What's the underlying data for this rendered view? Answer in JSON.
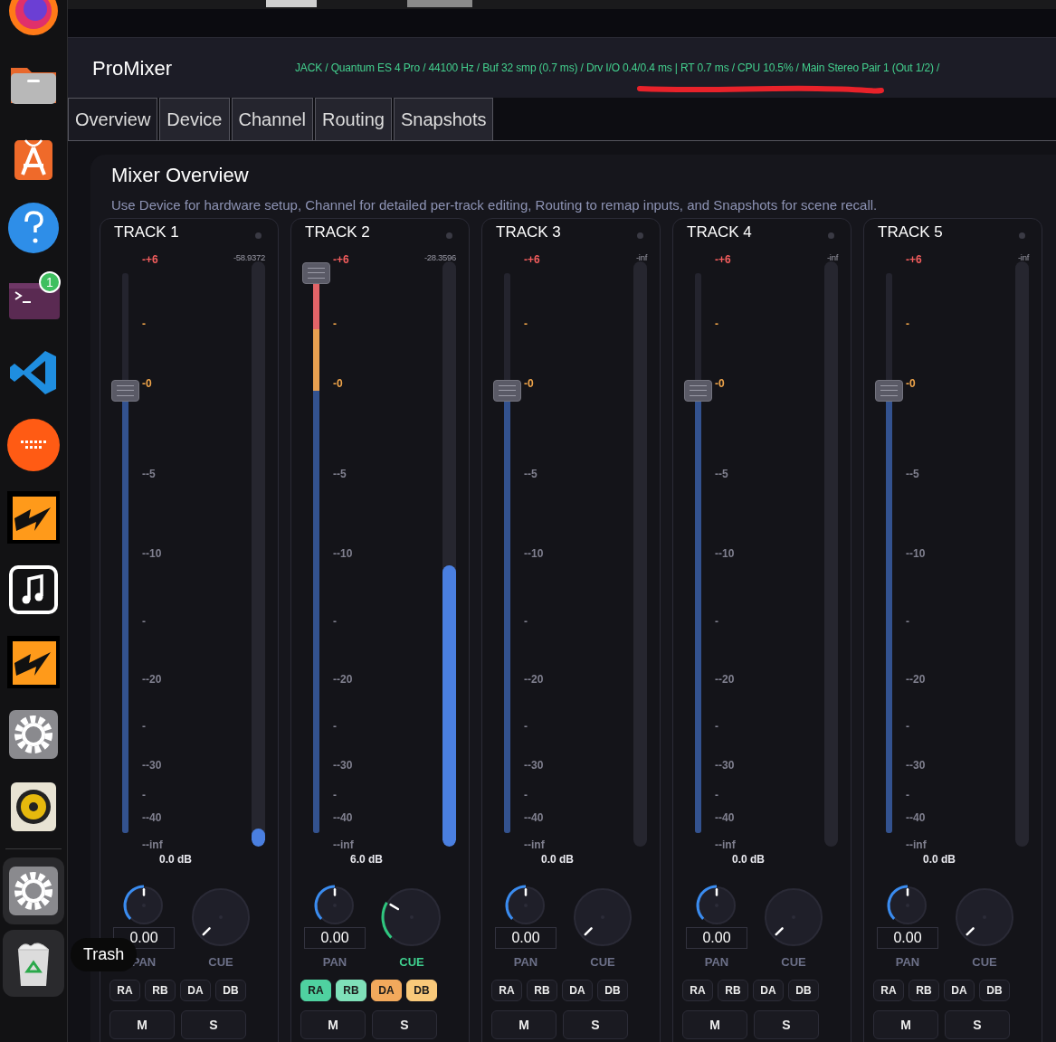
{
  "dock": {
    "items": [
      {
        "kind": "browser",
        "highlighted": false
      },
      {
        "kind": "folder",
        "highlighted": false
      },
      {
        "kind": "store",
        "highlighted": false
      },
      {
        "kind": "help",
        "highlighted": false
      },
      {
        "kind": "terminal",
        "highlighted": false,
        "badge": "1"
      },
      {
        "kind": "code",
        "highlighted": false
      },
      {
        "kind": "dots",
        "highlighted": false
      },
      {
        "kind": "lightning",
        "highlighted": false
      },
      {
        "kind": "music",
        "highlighted": false
      },
      {
        "kind": "lightning",
        "highlighted": false
      },
      {
        "kind": "gear",
        "highlighted": false
      },
      {
        "kind": "speaker",
        "highlighted": false
      },
      {
        "kind": "separator"
      },
      {
        "kind": "gear",
        "highlighted": true
      },
      {
        "kind": "trash",
        "highlighted": true
      }
    ],
    "tooltip": "Trash"
  },
  "app": {
    "title": "ProMixer",
    "status": "JACK / Quantum ES 4 Pro / 44100 Hz / Buf 32 smp (0.7 ms) / Drv I/O 0.4/0.4 ms | RT 0.7 ms / CPU 10.5% / Main Stereo Pair 1 (Out 1/2) /"
  },
  "tabs": [
    {
      "label": "Overview",
      "selected": true
    },
    {
      "label": "Device",
      "selected": false
    },
    {
      "label": "Channel",
      "selected": false
    },
    {
      "label": "Routing",
      "selected": false
    },
    {
      "label": "Snapshots",
      "selected": false
    }
  ],
  "panel": {
    "title": "Mixer Overview",
    "description": "Use Device for hardware setup, Channel for detailed per-track editing, Routing to remap inputs, and Snapshots for scene recall."
  },
  "tracks": [
    {
      "name": "TRACK 1",
      "peak": "-58.9372",
      "level": 0.79,
      "meter": {
        "level": 0.03
      },
      "scale": [
        {
          "label": "-+6",
          "kind": "hot"
        },
        {
          "label": "-",
          "kind": "warm"
        },
        {
          "label": "-0",
          "kind": "warm"
        },
        {
          "label": "--5",
          "kind": "normal"
        },
        {
          "label": "--10",
          "kind": "normal"
        },
        {
          "label": "-",
          "kind": "normal"
        },
        {
          "label": "--20",
          "kind": "normal"
        },
        {
          "label": "-",
          "kind": "normal"
        },
        {
          "label": "--30",
          "kind": "normal"
        },
        {
          "label": "-",
          "kind": "normal"
        },
        {
          "label": "--40",
          "kind": "normal"
        },
        {
          "label": "--inf",
          "kind": "normal"
        }
      ],
      "gain": "0.0 dB",
      "pan": {
        "level": 0.5,
        "value": "0.00",
        "label": "PAN"
      },
      "cue": {
        "active": false,
        "label": "CUE"
      },
      "sends": [
        {
          "label": "RA",
          "on": false
        },
        {
          "label": "RB",
          "on": false
        },
        {
          "label": "DA",
          "on": false
        },
        {
          "label": "DB",
          "on": false
        }
      ],
      "mute": "M",
      "solo": "S"
    },
    {
      "name": "TRACK 2",
      "peak": "-28.3596",
      "level": 1.0,
      "meter": {
        "level": 0.48
      },
      "scale": [
        {
          "label": "-+6",
          "kind": "hot"
        },
        {
          "label": "-",
          "kind": "warm"
        },
        {
          "label": "-0",
          "kind": "warm"
        },
        {
          "label": "--5",
          "kind": "normal"
        },
        {
          "label": "--10",
          "kind": "normal"
        },
        {
          "label": "-",
          "kind": "normal"
        },
        {
          "label": "--20",
          "kind": "normal"
        },
        {
          "label": "-",
          "kind": "normal"
        },
        {
          "label": "--30",
          "kind": "normal"
        },
        {
          "label": "-",
          "kind": "normal"
        },
        {
          "label": "--40",
          "kind": "normal"
        },
        {
          "label": "--inf",
          "kind": "normal"
        }
      ],
      "gain": "6.0 dB",
      "pan": {
        "level": 0.5,
        "value": "0.00",
        "label": "PAN"
      },
      "cue": {
        "active": true,
        "label": "CUE"
      },
      "sends": [
        {
          "label": "RA",
          "on": true,
          "color": "#4fd1a0"
        },
        {
          "label": "RB",
          "on": true,
          "color": "#7fe0b9"
        },
        {
          "label": "DA",
          "on": true,
          "color": "#f2a95c"
        },
        {
          "label": "DB",
          "on": true,
          "color": "#f9c97a"
        }
      ],
      "mute": "M",
      "solo": "S"
    },
    {
      "name": "TRACK 3",
      "peak": "-inf",
      "level": 0.79,
      "meter": {
        "level": 0
      },
      "scale": [
        {
          "label": "-+6",
          "kind": "hot"
        },
        {
          "label": "-",
          "kind": "warm"
        },
        {
          "label": "-0",
          "kind": "warm"
        },
        {
          "label": "--5",
          "kind": "normal"
        },
        {
          "label": "--10",
          "kind": "normal"
        },
        {
          "label": "-",
          "kind": "normal"
        },
        {
          "label": "--20",
          "kind": "normal"
        },
        {
          "label": "-",
          "kind": "normal"
        },
        {
          "label": "--30",
          "kind": "normal"
        },
        {
          "label": "-",
          "kind": "normal"
        },
        {
          "label": "--40",
          "kind": "normal"
        },
        {
          "label": "--inf",
          "kind": "normal"
        }
      ],
      "gain": "0.0 dB",
      "pan": {
        "level": 0.5,
        "value": "0.00",
        "label": "PAN"
      },
      "cue": {
        "active": false,
        "label": "CUE"
      },
      "sends": [
        {
          "label": "RA",
          "on": false
        },
        {
          "label": "RB",
          "on": false
        },
        {
          "label": "DA",
          "on": false
        },
        {
          "label": "DB",
          "on": false
        }
      ],
      "mute": "M",
      "solo": "S"
    },
    {
      "name": "TRACK 4",
      "peak": "-inf",
      "level": 0.79,
      "meter": {
        "level": 0
      },
      "scale": [
        {
          "label": "-+6",
          "kind": "hot"
        },
        {
          "label": "-",
          "kind": "warm"
        },
        {
          "label": "-0",
          "kind": "warm"
        },
        {
          "label": "--5",
          "kind": "normal"
        },
        {
          "label": "--10",
          "kind": "normal"
        },
        {
          "label": "-",
          "kind": "normal"
        },
        {
          "label": "--20",
          "kind": "normal"
        },
        {
          "label": "-",
          "kind": "normal"
        },
        {
          "label": "--30",
          "kind": "normal"
        },
        {
          "label": "-",
          "kind": "normal"
        },
        {
          "label": "--40",
          "kind": "normal"
        },
        {
          "label": "--inf",
          "kind": "normal"
        }
      ],
      "gain": "0.0 dB",
      "pan": {
        "level": 0.5,
        "value": "0.00",
        "label": "PAN"
      },
      "cue": {
        "active": false,
        "label": "CUE"
      },
      "sends": [
        {
          "label": "RA",
          "on": false
        },
        {
          "label": "RB",
          "on": false
        },
        {
          "label": "DA",
          "on": false
        },
        {
          "label": "DB",
          "on": false
        }
      ],
      "mute": "M",
      "solo": "S"
    },
    {
      "name": "TRACK 5",
      "peak": "-inf",
      "level": 0.79,
      "meter": {
        "level": 0
      },
      "scale": [
        {
          "label": "-+6",
          "kind": "hot"
        },
        {
          "label": "-",
          "kind": "warm"
        },
        {
          "label": "-0",
          "kind": "warm"
        },
        {
          "label": "--5",
          "kind": "normal"
        },
        {
          "label": "--10",
          "kind": "normal"
        },
        {
          "label": "-",
          "kind": "normal"
        },
        {
          "label": "--20",
          "kind": "normal"
        },
        {
          "label": "-",
          "kind": "normal"
        },
        {
          "label": "--30",
          "kind": "normal"
        },
        {
          "label": "-",
          "kind": "normal"
        },
        {
          "label": "--40",
          "kind": "normal"
        },
        {
          "label": "--inf",
          "kind": "normal"
        }
      ],
      "gain": "0.0 dB",
      "pan": {
        "level": 0.5,
        "value": "0.00",
        "label": "PAN"
      },
      "cue": {
        "active": false,
        "label": "CUE"
      },
      "sends": [
        {
          "label": "RA",
          "on": false
        },
        {
          "label": "RB",
          "on": false
        },
        {
          "label": "DA",
          "on": false
        },
        {
          "label": "DB",
          "on": false
        }
      ],
      "mute": "M",
      "solo": "S"
    }
  ]
}
